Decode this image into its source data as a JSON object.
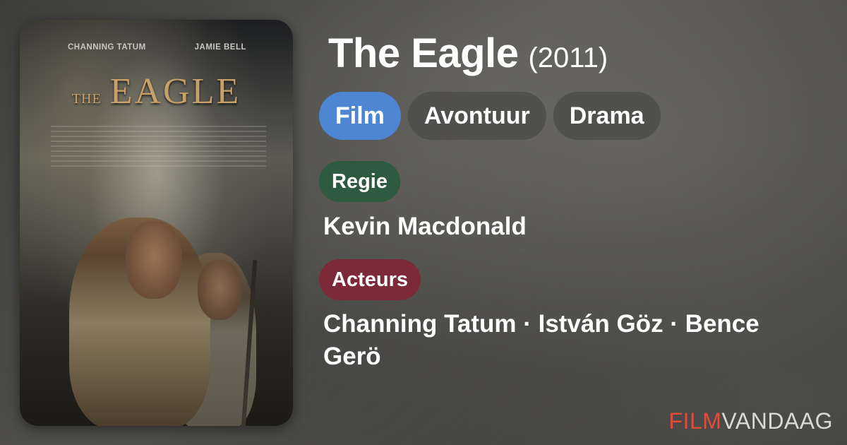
{
  "poster": {
    "credit_left": "CHANNING TATUM",
    "credit_right": "JAMIE BELL",
    "title_small": "THE",
    "title_large": "EAGLE"
  },
  "movie": {
    "title": "The Eagle",
    "year": "(2011)"
  },
  "genres": [
    {
      "label": "Film",
      "active": true
    },
    {
      "label": "Avontuur",
      "active": false
    },
    {
      "label": "Drama",
      "active": false
    }
  ],
  "director_section": {
    "label": "Regie",
    "value": "Kevin Macdonald"
  },
  "actors_section": {
    "label": "Acteurs",
    "value": "Channing Tatum · István Göz · Bence Gerö"
  },
  "brand": {
    "part1": "FILM",
    "part2": "VANDAAG"
  },
  "colors": {
    "genre_active": "#4f86d3",
    "genre_inactive": "#4e4e4c",
    "regie_badge": "#2e5a3f",
    "acteurs_badge": "#7c2a38",
    "brand_accent": "#e24a3a"
  }
}
